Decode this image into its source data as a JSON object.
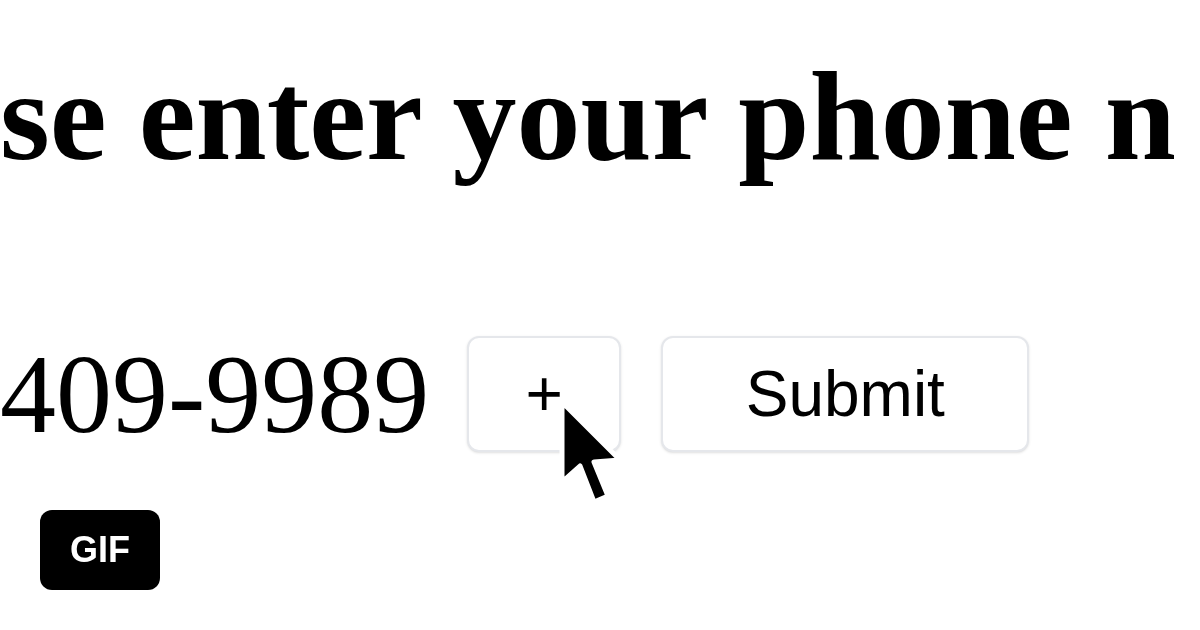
{
  "heading": "se enter your phone n",
  "phone_number": "409-9989",
  "buttons": [
    {
      "kind": "add",
      "label": "+"
    },
    {
      "kind": "submit",
      "label": "Submit"
    }
  ],
  "badge": "GIF"
}
